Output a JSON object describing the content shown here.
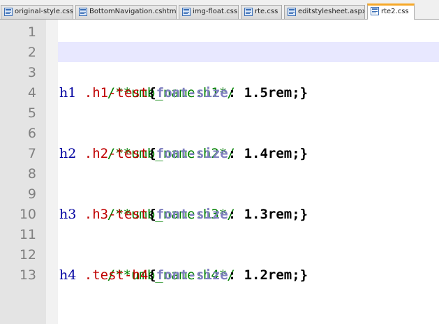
{
  "tabs": [
    {
      "label": "original-style.css",
      "icon": "file-icon",
      "active": false
    },
    {
      "label": "BottomNavigation.cshtml",
      "icon": "file-icon",
      "active": false
    },
    {
      "label": "img-float.css",
      "icon": "file-icon",
      "active": false
    },
    {
      "label": "rte.css",
      "icon": "file-icon",
      "active": false
    },
    {
      "label": "editstylesheet.aspx",
      "icon": "file-icon",
      "active": false
    },
    {
      "label": "rte2.css",
      "icon": "file-icon",
      "active": true
    }
  ],
  "colors": {
    "active_tab_accent": "#f6a828",
    "current_line_highlight": "#e8e8ff",
    "comment": "#008000",
    "selector_tag": "#0000a0",
    "selector_class": "#c00000",
    "property": "#8080c0"
  },
  "current_line": 2,
  "editor": {
    "line_numbers": [
      "1",
      "2",
      "3",
      "4",
      "5",
      "6",
      "7",
      "8",
      "9",
      "10",
      "11",
      "12",
      "13"
    ],
    "lines": [
      {
        "type": "blank"
      },
      {
        "type": "blank"
      },
      {
        "type": "comment",
        "text": "/**umb_name:h1*/"
      },
      {
        "type": "rule",
        "tag": "h1",
        "cls": ".h1-test",
        "open": "{",
        "prop": "font-size",
        "colon": ":",
        "value": " 1.5rem;",
        "close": "}"
      },
      {
        "type": "blank"
      },
      {
        "type": "comment",
        "text": "/**umb_name:h2*/"
      },
      {
        "type": "rule",
        "tag": "h2",
        "cls": ".h2-test",
        "open": "{",
        "prop": "font-size",
        "colon": ":",
        "value": " 1.4rem;",
        "close": "}"
      },
      {
        "type": "blank"
      },
      {
        "type": "comment",
        "text": "/**umb_name:h3*/"
      },
      {
        "type": "rule",
        "tag": "h3",
        "cls": ".h3-test",
        "open": "{",
        "prop": "font-size",
        "colon": ":",
        "value": " 1.3rem;",
        "close": "}"
      },
      {
        "type": "blank"
      },
      {
        "type": "comment",
        "text": "/**umb_name:h4*/"
      },
      {
        "type": "rule",
        "tag": "h4",
        "cls": ".test-h4",
        "open": "{",
        "prop": "font-size",
        "colon": ":",
        "value": " 1.2rem;",
        "close": "}"
      }
    ]
  }
}
